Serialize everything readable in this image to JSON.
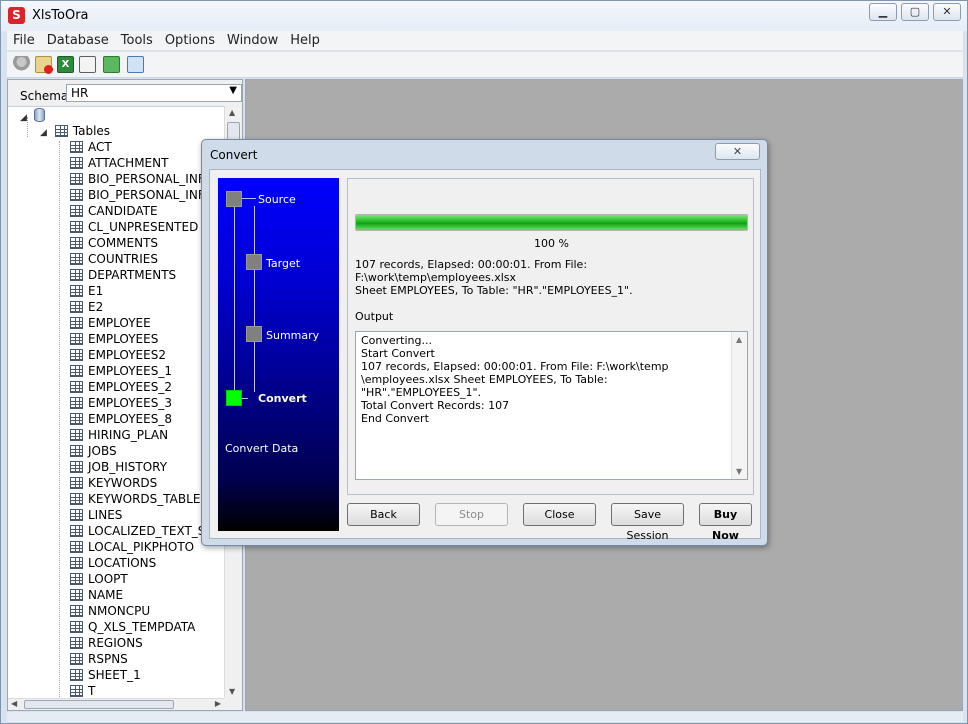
{
  "app": {
    "title": "XlsToOra",
    "icon": "app-logo-icon"
  },
  "window_controls": [
    "minimize-icon",
    "maximize-icon",
    "close-icon"
  ],
  "menu": [
    "File",
    "Database",
    "Tools",
    "Options",
    "Window",
    "Help"
  ],
  "toolbar": {
    "icons": [
      "connect-icon",
      "disconnect-icon",
      "excel-icon",
      "report-icon",
      "refresh-icon",
      "grid-icon"
    ]
  },
  "left_panel": {
    "schema_label": "Schema",
    "schema_value": "HR",
    "tables_label": "Tables",
    "tables": [
      "ACT",
      "ATTACHMENT",
      "BIO_PERSONAL_INFO",
      "BIO_PERSONAL_INFO",
      "CANDIDATE",
      "CL_UNPRESENTED",
      "COMMENTS",
      "COUNTRIES",
      "DEPARTMENTS",
      "E1",
      "E2",
      "EMPLOYEE",
      "EMPLOYEES",
      "EMPLOYEES2",
      "EMPLOYEES_1",
      "EMPLOYEES_2",
      "EMPLOYEES_3",
      "EMPLOYEES_8",
      "HIRING_PLAN",
      "JOBS",
      "JOB_HISTORY",
      "KEYWORDS",
      "KEYWORDS_TABLE",
      "LINES",
      "LOCALIZED_TEXT_SI",
      "LOCAL_PIKPHOTO",
      "LOCATIONS",
      "LOOPT",
      "NAME",
      "NMONCPU",
      "Q_XLS_TEMPDATA",
      "REGIONS",
      "RSPNS",
      "SHEET_1",
      "T"
    ]
  },
  "dialog": {
    "title": "Convert",
    "close_glyph": "✕",
    "steps": [
      {
        "label": "Source",
        "active": false
      },
      {
        "label": "Target",
        "active": false
      },
      {
        "label": "Summary",
        "active": false
      },
      {
        "label": "Convert",
        "active": true
      }
    ],
    "steps_description": "Convert Data",
    "progress_fraction": 1.0,
    "progress_text": "100 %",
    "info_line1": "107 records,    Elapsed: 00:00:01.    From File: F:\\work\\temp\\employees.xlsx",
    "info_line2": "Sheet EMPLOYEES,     To Table: \"HR\".\"EMPLOYEES_1\".",
    "output_label": "Output",
    "output_lines": [
      "Converting...",
      "Start Convert",
      "107 records,    Elapsed: 00:00:01.    From File: F:\\work\\temp",
      "\\employees.xlsx Sheet EMPLOYEES,     To Table: \"HR\".\"EMPLOYEES_1\".",
      "Total Convert Records: 107",
      "End Convert"
    ],
    "buttons": {
      "back": "Back",
      "stop": "Stop",
      "close": "Close",
      "save_session": "Save Session",
      "buy_now": "Buy Now"
    }
  }
}
